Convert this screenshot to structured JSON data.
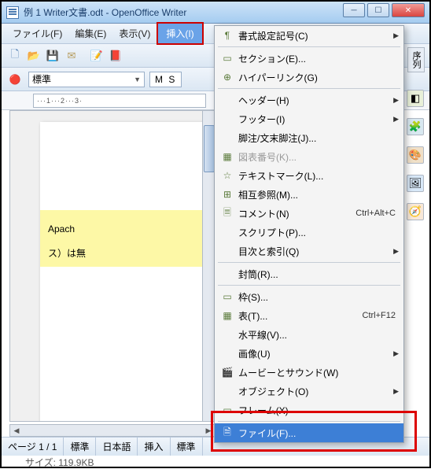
{
  "titlebar": {
    "title": "例 1 Writer文書.odt - OpenOffice Writer"
  },
  "menubar": {
    "file": "ファイル(F)",
    "edit": "編集(E)",
    "view": "表示(V)",
    "insert": "挿入(I)"
  },
  "formatbar": {
    "style": "標準",
    "font_prefix": "M S"
  },
  "ruler": {
    "text": "···1···2···3·"
  },
  "page": {
    "line1": "Apach",
    "line2": "ス）は無"
  },
  "side_tab": "序列",
  "dropdown": [
    {
      "icon": "¶",
      "label": "書式設定記号(C)",
      "arrow": true
    },
    {
      "sep": true
    },
    {
      "icon": "▭",
      "label": "セクション(E)...",
      "arrow": false
    },
    {
      "icon": "⊕",
      "label": "ハイパーリンク(G)",
      "arrow": false
    },
    {
      "sep": true
    },
    {
      "icon": "",
      "label": "ヘッダー(H)",
      "arrow": true
    },
    {
      "icon": "",
      "label": "フッター(I)",
      "arrow": true
    },
    {
      "icon": "",
      "label": "脚注/文末脚注(J)...",
      "arrow": false
    },
    {
      "icon": "▦",
      "label": "図表番号(K)...",
      "arrow": false,
      "disabled": true
    },
    {
      "icon": "☆",
      "label": "テキストマーク(L)...",
      "arrow": false
    },
    {
      "icon": "⊞",
      "label": "相互参照(M)...",
      "arrow": false
    },
    {
      "icon": "🗏",
      "label": "コメント(N)",
      "shortcut": "Ctrl+Alt+C",
      "arrow": false
    },
    {
      "icon": "",
      "label": "スクリプト(P)...",
      "arrow": false
    },
    {
      "icon": "",
      "label": "目次と索引(Q)",
      "arrow": true
    },
    {
      "sep": true
    },
    {
      "icon": "",
      "label": "封筒(R)...",
      "arrow": false
    },
    {
      "sep": true
    },
    {
      "icon": "▭",
      "label": "枠(S)...",
      "arrow": false
    },
    {
      "icon": "▦",
      "label": "表(T)...",
      "shortcut": "Ctrl+F12",
      "arrow": false
    },
    {
      "icon": "",
      "label": "水平線(V)...",
      "arrow": false
    },
    {
      "icon": "",
      "label": "画像(U)",
      "arrow": true
    },
    {
      "icon": "🎬",
      "label": "ムービーとサウンド(W)",
      "arrow": false
    },
    {
      "icon": "",
      "label": "オブジェクト(O)",
      "arrow": true
    },
    {
      "icon": "▭",
      "label": "フレーム(X)",
      "arrow": false
    },
    {
      "sep": true
    },
    {
      "icon": "🗎",
      "label": "ファイル(F)...",
      "arrow": false,
      "selected": true
    }
  ],
  "statusbar": {
    "page": "ページ 1 / 1",
    "std": "標準",
    "lang": "日本語",
    "mode": "挿入",
    "std2": "標準"
  },
  "bottom": {
    "size": "サイズ: 119.9KB"
  }
}
